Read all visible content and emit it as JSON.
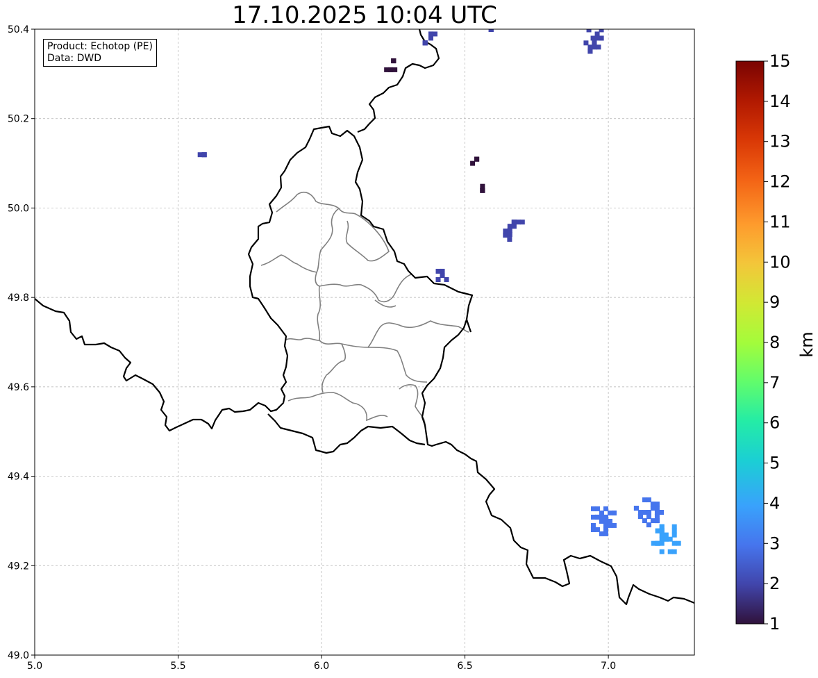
{
  "title": "17.10.2025 10:04 UTC",
  "info_box": {
    "product": "Product: Echotop (PE)",
    "data": "Data: DWD"
  },
  "map": {
    "lon_range": [
      5.0,
      7.3
    ],
    "lat_range": [
      49.0,
      50.4
    ],
    "x_ticks": [
      "5.0",
      "5.5",
      "6.0",
      "6.5",
      "7.0"
    ],
    "y_ticks": [
      "49.0",
      "49.2",
      "49.4",
      "49.6",
      "49.8",
      "50.0",
      "50.2",
      "50.4"
    ],
    "gridlines": true,
    "border_color": "#000000",
    "district_color": "#808080"
  },
  "colorbar": {
    "label": "km",
    "min": 1,
    "max": 15,
    "ticks": [
      "1",
      "2",
      "3",
      "4",
      "5",
      "6",
      "7",
      "8",
      "9",
      "10",
      "11",
      "12",
      "13",
      "14",
      "15"
    ],
    "colormap": "turbo"
  },
  "echo_cells": [
    {
      "lon": 5.59,
      "lat": 50.12,
      "value": 2.0
    },
    {
      "lon": 6.54,
      "lat": 50.11,
      "value": 1.2
    },
    {
      "lon": 6.56,
      "lat": 50.04,
      "value": 1.3
    },
    {
      "lon": 6.64,
      "lat": 49.94,
      "value": 1.8
    },
    {
      "lon": 6.67,
      "lat": 49.96,
      "value": 2.1
    },
    {
      "lon": 6.42,
      "lat": 49.85,
      "value": 2.2
    },
    {
      "lon": 6.24,
      "lat": 50.31,
      "value": 1.4
    },
    {
      "lon": 6.25,
      "lat": 50.33,
      "value": 1.4
    },
    {
      "lon": 6.36,
      "lat": 50.37,
      "value": 1.6
    },
    {
      "lon": 6.38,
      "lat": 50.39,
      "value": 1.6
    },
    {
      "lon": 6.59,
      "lat": 50.4,
      "value": 2.0
    },
    {
      "lon": 6.95,
      "lat": 50.37,
      "value": 2.2
    },
    {
      "lon": 6.96,
      "lat": 50.39,
      "value": 2.3
    },
    {
      "lon": 6.99,
      "lat": 49.3,
      "value": 3.4
    },
    {
      "lon": 7.14,
      "lat": 49.32,
      "value": 3.4
    },
    {
      "lon": 7.2,
      "lat": 49.26,
      "value": 3.5
    }
  ]
}
